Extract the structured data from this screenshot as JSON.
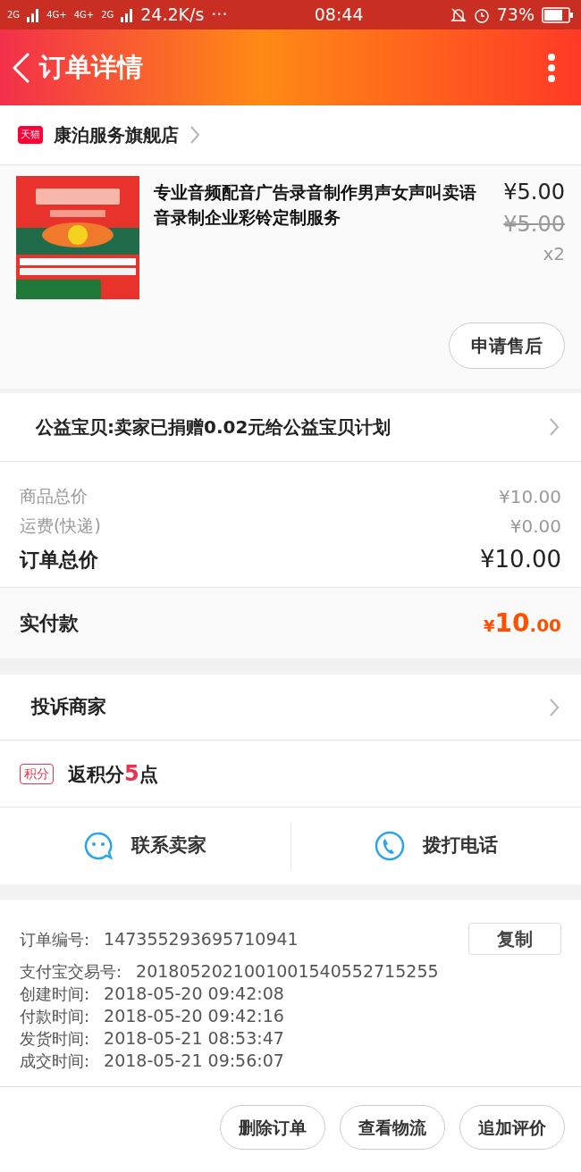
{
  "status_bar": {
    "network_1": "2G",
    "network_2": "4G+",
    "network_3": "4G+",
    "network_4": "2G",
    "speed": "24.2K/s",
    "more": "···",
    "time": "08:44",
    "battery": "73%"
  },
  "header": {
    "title": "订单详情"
  },
  "store": {
    "badge": "天猫",
    "name": "康泊服务旗舰店"
  },
  "product": {
    "title": "专业音频配音广告录音制作男声女声叫卖语音录制企业彩铃定制服务",
    "price": "¥5.00",
    "original_price": "¥5.00",
    "quantity": "x2",
    "action": "申请售后"
  },
  "charity": {
    "text": "公益宝贝:卖家已捐赠0.02元给公益宝贝计划"
  },
  "costs": [
    {
      "label": "商品总价",
      "value": "¥10.00",
      "kind": "minor"
    },
    {
      "label": "运费(快递)",
      "value": "¥0.00",
      "kind": "minor"
    },
    {
      "label": "订单总价",
      "value": "¥10.00",
      "kind": "total"
    }
  ],
  "paid": {
    "label": "实付款",
    "currency": "¥",
    "whole": "10",
    "cents": ".00"
  },
  "complaint": {
    "text": "投诉商家"
  },
  "points": {
    "badge": "积分",
    "prefix": "返积分",
    "amount": "5",
    "suffix": "点"
  },
  "contact": [
    {
      "kind": "chat",
      "label": "联系卖家"
    },
    {
      "kind": "phone",
      "label": "拨打电话"
    }
  ],
  "order_info": {
    "copy_button": "复制",
    "rows": [
      {
        "label": "订单编号:",
        "value": "147355293695710941"
      },
      {
        "label": "支付宝交易号:",
        "value": "2018052021001001540552715255"
      },
      {
        "label": "创建时间:",
        "value": "2018-05-20 09:42:08"
      },
      {
        "label": "付款时间:",
        "value": "2018-05-20 09:42:16"
      },
      {
        "label": "发货时间:",
        "value": "2018-05-21 08:53:47"
      },
      {
        "label": "成交时间:",
        "value": "2018-05-21 09:56:07"
      }
    ]
  },
  "actions": [
    "删除订单",
    "查看物流",
    "追加评价"
  ]
}
